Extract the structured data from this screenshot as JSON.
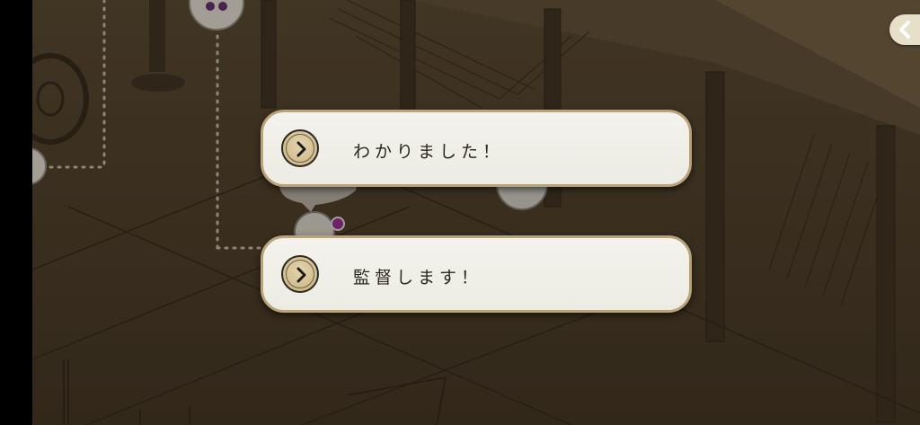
{
  "choices": [
    {
      "label": "わかりました！"
    },
    {
      "label": "監督します！"
    }
  ],
  "back_button": {
    "icon": "chevron-left-icon"
  },
  "colors": {
    "scene_background": "#4a3d2a",
    "choice_fill": "#f1efe8",
    "choice_border": "#b9a479",
    "play_button_fill": "#d6c497",
    "notification_dot": "#8e2a8a",
    "map_dotted_path": "#b9b4a6"
  }
}
